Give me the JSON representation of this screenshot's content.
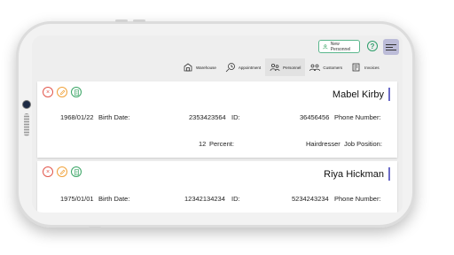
{
  "header": {
    "new_button_label": "New Personnel",
    "help_label": "?"
  },
  "nav": {
    "items": [
      {
        "label": "Warehouse",
        "icon": "warehouse-icon"
      },
      {
        "label": "Appointment",
        "icon": "appointment-icon"
      },
      {
        "label": "Personnel",
        "icon": "personnel-icon",
        "active": true
      },
      {
        "label": "Customers",
        "icon": "customers-icon"
      },
      {
        "label": "Invoices",
        "icon": "invoices-icon"
      }
    ]
  },
  "colors": {
    "accent_green": "#3aa565",
    "delete_red": "#e2574c",
    "edit_orange": "#f0a23a",
    "name_bar": "#6b6bc8",
    "menu_bg": "#bcbcd8"
  },
  "personnel": [
    {
      "name": "Mabel Kirby",
      "birth_date": "1968/01/22",
      "birth_date_label": "Birth Date:",
      "id": "2353423564",
      "id_label": "ID:",
      "phone": "36456456",
      "phone_label": "Phone Number:",
      "percent": "12",
      "percent_label": "Percent:",
      "job": "Hairdresser",
      "job_label": "Job Position:"
    },
    {
      "name": "Riya Hickman",
      "birth_date": "1975/01/01",
      "birth_date_label": "Birth Date:",
      "id": "12342134234",
      "id_label": "ID:",
      "phone": "5234243234",
      "phone_label": "Phone Number:"
    }
  ]
}
